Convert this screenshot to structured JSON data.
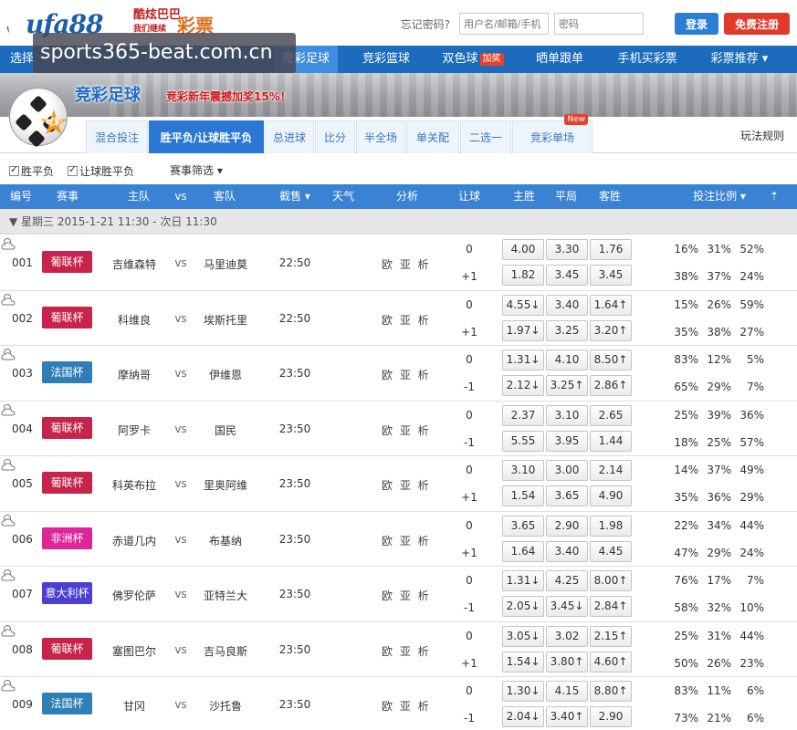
{
  "header": {
    "logo_text": "ufa88",
    "slogan_line1": "酷炫巴巴",
    "slogan_line2": "我们继续",
    "logo_caipiao": "彩票",
    "forgot": "忘记密码?",
    "username_placeholder": "用户名/邮箱/手机",
    "password_placeholder": "密码",
    "login_label": "登录",
    "register_label": "免费注册"
  },
  "watermark": "sports365-beat.com.cn",
  "nav": {
    "items": [
      {
        "label": "选择"
      },
      {
        "label": "竞彩足球"
      },
      {
        "label": "竞彩篮球"
      },
      {
        "label": "双色球",
        "badge": "加奖"
      },
      {
        "label": "晒单跟单"
      },
      {
        "label": "手机买彩票"
      },
      {
        "label": "彩票推荐 ▾"
      }
    ]
  },
  "banner": {
    "title": "竞彩足球",
    "promo": "竞彩新年震撼加奖15%！",
    "badge": "竞彩"
  },
  "tabs": [
    {
      "label": "混合投注"
    },
    {
      "label": "胜平负/让球胜平负"
    },
    {
      "label": "总进球"
    },
    {
      "label": "比分"
    },
    {
      "label": "半全场"
    },
    {
      "label": "单关配"
    },
    {
      "label": "二选一"
    },
    {
      "label": "竞彩单场",
      "badge": "New"
    }
  ],
  "rules_label": "玩法规则",
  "filters": {
    "cb1": "胜平负",
    "cb2": "让球胜平负",
    "select": "赛事筛选 ▾"
  },
  "table_header": {
    "no": "编号",
    "league": "赛事",
    "home": "主队",
    "vs": "vs",
    "away": "客队",
    "deadline": "截售 ▾",
    "weather": "天气",
    "analysis": "分析",
    "handicap": "让球",
    "win": "主胜",
    "draw": "平局",
    "lose": "客胜",
    "ratio": "投注比例 ▾",
    "top": "⇡"
  },
  "date_row": "▼ 星期三 2015-1-21 11:30 - 次日 11:30",
  "analysis_label": "欧 亚 析",
  "matches": [
    {
      "no": "001",
      "league": "葡联杯",
      "league_color": "#c8234a",
      "home": "吉维森特",
      "vs": "vs",
      "away": "马里迪莫",
      "time": "22:50",
      "h1": "0",
      "h2": "+1",
      "odds1": [
        "4.00",
        "3.30",
        "1.76"
      ],
      "odds2": [
        "1.82",
        "3.45",
        "3.45"
      ],
      "pct1": [
        "16%",
        "31%",
        "52%"
      ],
      "pct2": [
        "38%",
        "37%",
        "24%"
      ]
    },
    {
      "no": "002",
      "league": "葡联杯",
      "league_color": "#c8234a",
      "home": "科维良",
      "vs": "vs",
      "away": "埃斯托里",
      "time": "22:50",
      "h1": "0",
      "h2": "+1",
      "odds1": [
        "4.55↓",
        "3.40",
        "1.64↑"
      ],
      "odds2": [
        "1.97↓",
        "3.25",
        "3.20↑"
      ],
      "pct1": [
        "15%",
        "26%",
        "59%"
      ],
      "pct2": [
        "35%",
        "38%",
        "27%"
      ]
    },
    {
      "no": "003",
      "league": "法国杯",
      "league_color": "#2f7fb6",
      "home": "摩纳哥",
      "vs": "vs",
      "away": "伊维恩",
      "time": "23:50",
      "h1": "0",
      "h2": "-1",
      "odds1": [
        "1.31↓",
        "4.10",
        "8.50↑"
      ],
      "odds2": [
        "2.12↓",
        "3.25↑",
        "2.86↑"
      ],
      "pct1": [
        "83%",
        "12%",
        "5%"
      ],
      "pct2": [
        "65%",
        "29%",
        "7%"
      ]
    },
    {
      "no": "004",
      "league": "葡联杯",
      "league_color": "#c8234a",
      "home": "阿罗卡",
      "vs": "vs",
      "away": "国民",
      "time": "23:50",
      "h1": "0",
      "h2": "-1",
      "odds1": [
        "2.37",
        "3.10",
        "2.65"
      ],
      "odds2": [
        "5.55",
        "3.95",
        "1.44"
      ],
      "pct1": [
        "25%",
        "39%",
        "36%"
      ],
      "pct2": [
        "18%",
        "25%",
        "57%"
      ]
    },
    {
      "no": "005",
      "league": "葡联杯",
      "league_color": "#c8234a",
      "home": "科英布拉",
      "vs": "vs",
      "away": "里奥阿维",
      "time": "23:50",
      "h1": "0",
      "h2": "+1",
      "odds1": [
        "3.10",
        "3.00",
        "2.14"
      ],
      "odds2": [
        "1.54",
        "3.65",
        "4.90"
      ],
      "pct1": [
        "14%",
        "37%",
        "49%"
      ],
      "pct2": [
        "35%",
        "36%",
        "29%"
      ]
    },
    {
      "no": "006",
      "league": "非洲杯",
      "league_color": "#e0259a",
      "home": "赤道几内",
      "vs": "vs",
      "away": "布基纳",
      "time": "23:50",
      "h1": "0",
      "h2": "+1",
      "odds1": [
        "3.65",
        "2.90",
        "1.98"
      ],
      "odds2": [
        "1.64",
        "3.40",
        "4.45"
      ],
      "pct1": [
        "22%",
        "34%",
        "44%"
      ],
      "pct2": [
        "47%",
        "29%",
        "24%"
      ]
    },
    {
      "no": "007",
      "league": "意大利杯",
      "league_color": "#4a3fd2",
      "home": "佛罗伦萨",
      "vs": "vs",
      "away": "亚特兰大",
      "time": "23:50",
      "h1": "0",
      "h2": "-1",
      "odds1": [
        "1.31↓",
        "4.25",
        "8.00↑"
      ],
      "odds2": [
        "2.05↓",
        "3.45↓",
        "2.84↑"
      ],
      "pct1": [
        "76%",
        "17%",
        "7%"
      ],
      "pct2": [
        "58%",
        "32%",
        "10%"
      ]
    },
    {
      "no": "008",
      "league": "葡联杯",
      "league_color": "#c8234a",
      "home": "塞图巴尔",
      "vs": "vs",
      "away": "吉马良斯",
      "time": "23:50",
      "h1": "0",
      "h2": "+1",
      "odds1": [
        "3.05↓",
        "3.02",
        "2.15↑"
      ],
      "odds2": [
        "1.54↓",
        "3.80↑",
        "4.60↑"
      ],
      "pct1": [
        "25%",
        "31%",
        "44%"
      ],
      "pct2": [
        "50%",
        "26%",
        "23%"
      ]
    },
    {
      "no": "009",
      "league": "法国杯",
      "league_color": "#2f7fb6",
      "home": "甘冈",
      "vs": "vs",
      "away": "沙托鲁",
      "time": "23:50",
      "h1": "0",
      "h2": "-1",
      "odds1": [
        "1.30↓",
        "4.15",
        "8.80↑"
      ],
      "odds2": [
        "2.04↓",
        "3.40↑",
        "2.90"
      ],
      "pct1": [
        "83%",
        "11%",
        "6%"
      ],
      "pct2": [
        "73%",
        "21%",
        "6%"
      ]
    }
  ]
}
